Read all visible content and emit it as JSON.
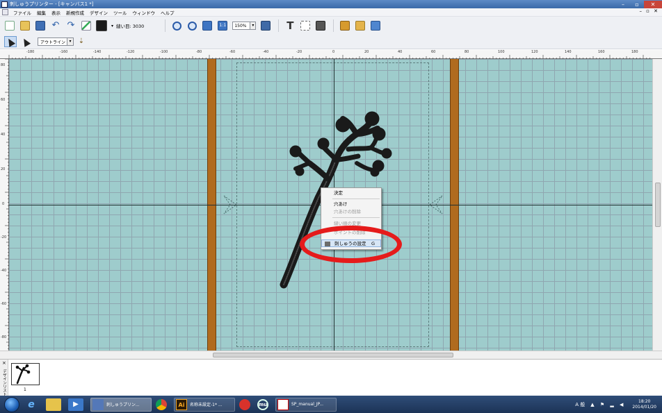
{
  "window": {
    "title": "刺しゅうプリンター - [キャンバス1 *]",
    "controls": [
      "–",
      "▫",
      "✕"
    ]
  },
  "menubar": {
    "items": [
      "ファイル",
      "編集",
      "表示",
      "新規作成",
      "デザイン",
      "ツール",
      "ウィンドウ",
      "ヘルプ"
    ],
    "mdi_controls": "– ▫ ✕"
  },
  "toolbar": {
    "stitch_count_label": "縫い目: 3030",
    "zoom_value": "150%",
    "dropdown_arrow": "▾"
  },
  "toolbar2": {
    "outline_mode": "アウトライン"
  },
  "rulers": {
    "top_labels": [
      "-180",
      "-160",
      "-140",
      "-120",
      "-100",
      "-80",
      "-60",
      "-40",
      "-20",
      "0",
      "20",
      "40",
      "60",
      "80",
      "100",
      "120",
      "140",
      "160",
      "180"
    ],
    "left_labels": [
      "80",
      "60",
      "40",
      "20",
      "0",
      "-20",
      "-40",
      "-60",
      "-80"
    ]
  },
  "context_menu": {
    "items": [
      {
        "label": "決定",
        "enabled": true
      },
      {
        "label": "穴あけ",
        "enabled": true
      },
      {
        "label": "穴あけの削除",
        "enabled": false
      },
      {
        "label": "縫い順の変更",
        "enabled": false
      },
      {
        "label": "ポイントの削除",
        "enabled": false
      },
      {
        "label": "刺しゅうの設定",
        "enabled": true,
        "shortcut": "G"
      }
    ]
  },
  "pattern_panel": {
    "close": "×",
    "side_label": "デザインリスト",
    "thumb_number": "1"
  },
  "taskbar": {
    "tasks": [
      {
        "label": "刺しゅうプリン...",
        "active": true
      },
      {
        "label": "名称未設定-1* ...",
        "active": false
      },
      {
        "label": "SP_manual_JP...",
        "active": false
      }
    ],
    "ai_label": "Ai",
    "mu_label": "mu",
    "ime": "A 般",
    "tray_icons": "▲ ⚑ ▂ ◀",
    "time": "18:20",
    "date": "2014/01/20"
  },
  "colors": {
    "canvas": "#9ecccc",
    "hoop_bar": "#b06b1e",
    "highlight_ellipse": "#e51b1b",
    "thread": "#1a1a1a"
  }
}
